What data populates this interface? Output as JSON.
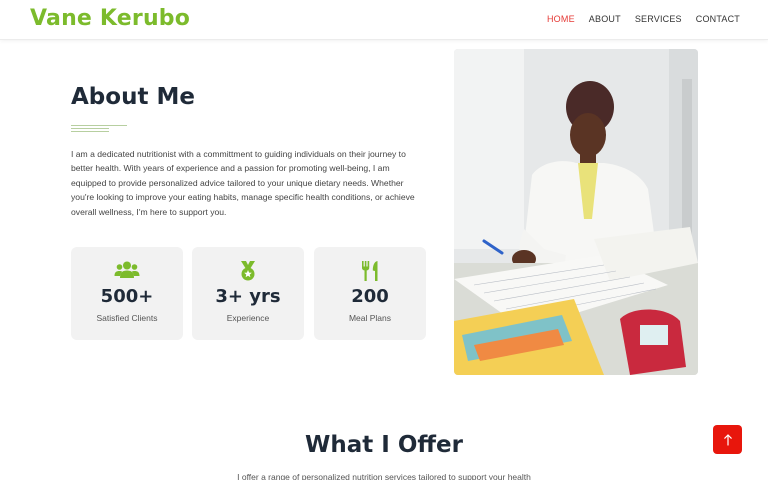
{
  "brand": {
    "name": "Vane Kerubo",
    "color": "#7cbb2c"
  },
  "nav": {
    "items": [
      {
        "label": "HOME",
        "active": true
      },
      {
        "label": "ABOUT",
        "active": false
      },
      {
        "label": "SERVICES",
        "active": false
      },
      {
        "label": "CONTACT",
        "active": false
      }
    ],
    "active_color": "#e53935"
  },
  "about": {
    "title": "About Me",
    "text": "I am a dedicated nutritionist with a committment to guiding individuals on their journey to better health. With years of experience and a passion for promoting well-being, I am equipped to provide personalized advice tailored to your unique dietary needs. Whether you're looking to improve your eating habits, manage specific health conditions, or achieve overall wellness, I'm here to support you.",
    "photo_alt": "Nutritionist working at a desk with documents",
    "stats": [
      {
        "icon": "users-icon",
        "value": "500+",
        "label": "Satisfied Clients"
      },
      {
        "icon": "medal-icon",
        "value": "3+ yrs",
        "label": "Experience"
      },
      {
        "icon": "utensils-icon",
        "value": "200",
        "label": "Meal Plans"
      }
    ]
  },
  "offer": {
    "title": "What I Offer",
    "intro": "I offer a range of personalized nutrition services tailored to support your health"
  },
  "scroll_top": {
    "icon": "arrow-up-icon",
    "color": "#e8160c"
  },
  "accent_color": "#7cbb2c"
}
